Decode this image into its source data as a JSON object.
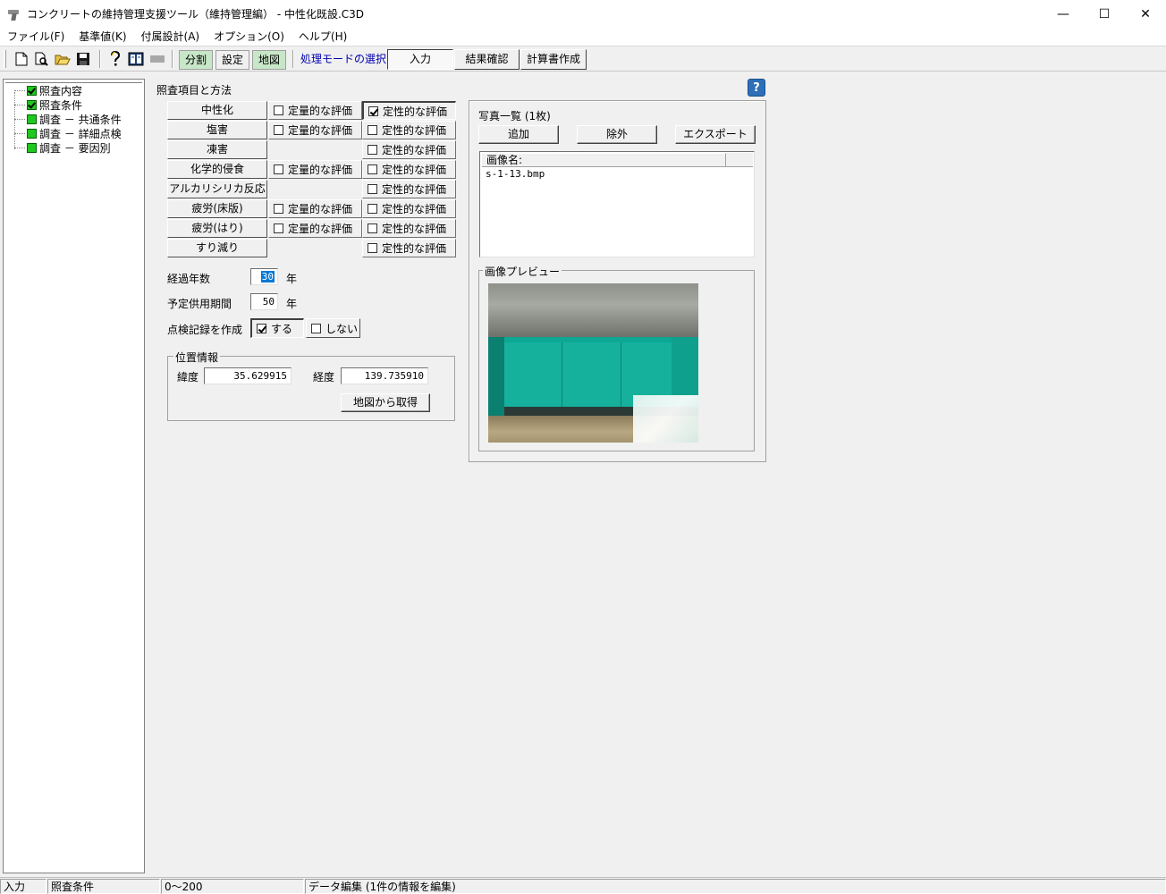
{
  "window": {
    "title": "コンクリートの維持管理支援ツール（維持管理編） - 中性化既設.C3D",
    "minimize": "—",
    "maximize": "☐",
    "close": "✕"
  },
  "menu": [
    "ファイル(F)",
    "基準値(K)",
    "付属設計(A)",
    "オプション(O)",
    "ヘルプ(H)"
  ],
  "toolbar": {
    "btn_split": "分割",
    "btn_settings": "設定",
    "btn_map": "地図",
    "mode_label": "処理モードの選択",
    "tab_input": "入力",
    "tab_results": "結果確認",
    "tab_report": "計算書作成"
  },
  "tree": [
    {
      "label": "照査内容",
      "checked": true
    },
    {
      "label": "照査条件",
      "checked": true
    },
    {
      "label": "調査 － 共通条件",
      "checked": false
    },
    {
      "label": "調査 － 詳細点検",
      "checked": false
    },
    {
      "label": "調査 － 要因別",
      "checked": false
    }
  ],
  "section_title": "照査項目と方法",
  "help_icon": "?",
  "items": [
    {
      "label": "中性化",
      "quantitative": "定量的な評価",
      "qualitative": "定性的な評価"
    },
    {
      "label": "塩害",
      "quantitative": "定量的な評価",
      "qualitative": "定性的な評価"
    },
    {
      "label": "凍害",
      "quantitative": "",
      "qualitative": "定性的な評価"
    },
    {
      "label": "化学的侵食",
      "quantitative": "定量的な評価",
      "qualitative": "定性的な評価"
    },
    {
      "label": "アルカリシリカ反応",
      "quantitative": "",
      "qualitative": "定性的な評価"
    },
    {
      "label": "疲労(床版)",
      "quantitative": "定量的な評価",
      "qualitative": "定性的な評価"
    },
    {
      "label": "疲労(はり)",
      "quantitative": "定量的な評価",
      "qualitative": "定性的な評価"
    },
    {
      "label": "すり減り",
      "quantitative": "",
      "qualitative": "定性的な評価"
    }
  ],
  "elapsed_years": {
    "label": "経過年数",
    "value": "30",
    "unit": "年"
  },
  "service_period": {
    "label": "予定供用期間",
    "value": "50",
    "unit": "年"
  },
  "inspection_record": {
    "label": "点検記録を作成",
    "yes": "する",
    "no": "しない"
  },
  "location": {
    "title": "位置情報",
    "lat_label": "緯度",
    "lat_value": "35.629915",
    "lon_label": "経度",
    "lon_value": "139.735910",
    "map_button": "地図から取得"
  },
  "photos": {
    "title": "写真一覧 (1枚)",
    "add": "追加",
    "remove": "除外",
    "export": "エクスポート",
    "column": "画像名:",
    "rows": [
      "s-1-13.bmp"
    ],
    "preview_title": "画像プレビュー"
  },
  "status": {
    "mode": "入力",
    "page": "照査条件",
    "range": "0～200",
    "message": "データ編集 (1件の情報を編集)"
  }
}
